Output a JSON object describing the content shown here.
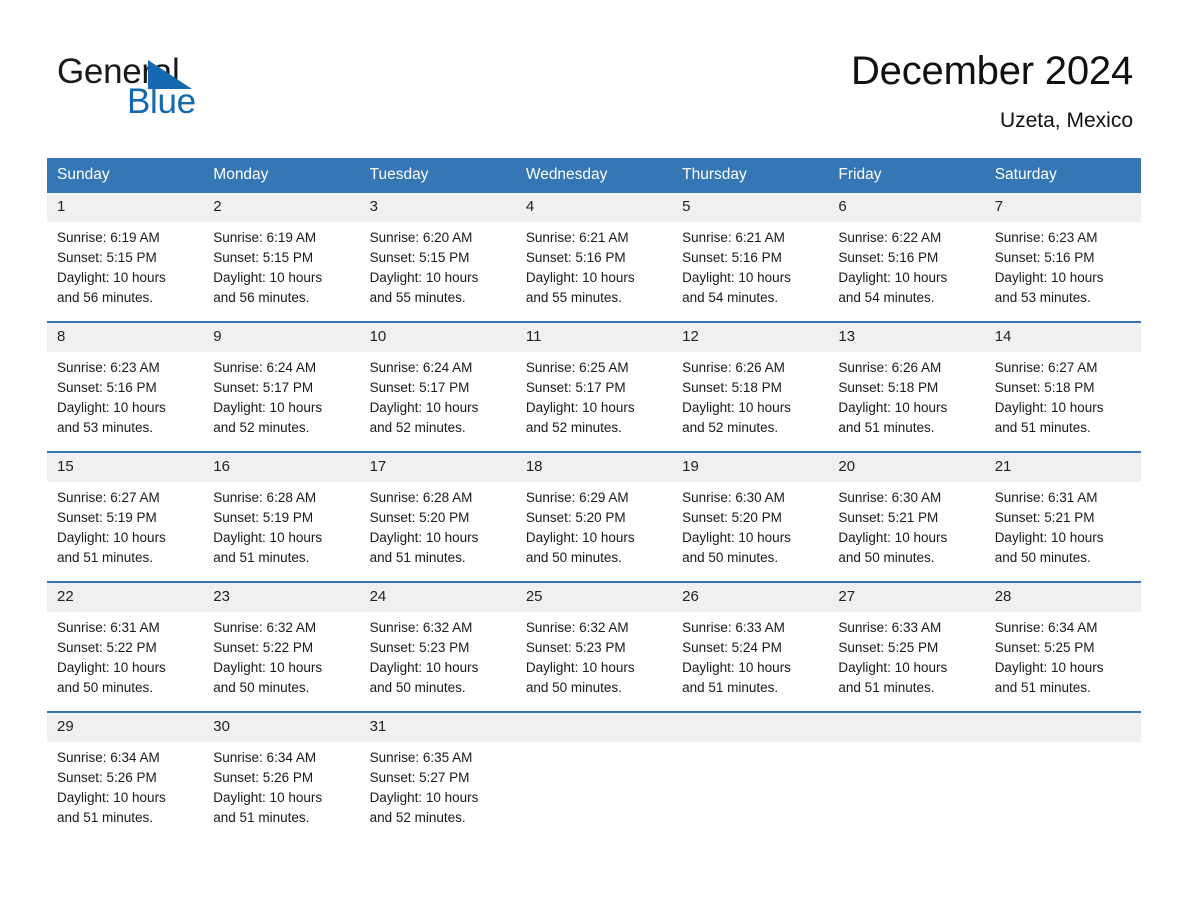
{
  "brand": {
    "name_part1": "General",
    "name_part2": "Blue",
    "triangle_color": "#1569b0",
    "blue_color": "#1569b0"
  },
  "header": {
    "title": "December 2024",
    "subtitle": "Uzeta, Mexico"
  },
  "theme": {
    "header_bar": "#3576b5",
    "row_divider": "#3576b5",
    "daynum_background": "#f0f0f0",
    "page_background": "#ffffff"
  },
  "weekdays": [
    "Sunday",
    "Monday",
    "Tuesday",
    "Wednesday",
    "Thursday",
    "Friday",
    "Saturday"
  ],
  "labels": {
    "sunrise_prefix": "Sunrise:",
    "sunset_prefix": "Sunset:",
    "daylight_prefix": "Daylight:"
  },
  "weeks": [
    [
      {
        "day": "1",
        "sunrise": "Sunrise: 6:19 AM",
        "sunset": "Sunset: 5:15 PM",
        "daylight_line1": "Daylight: 10 hours",
        "daylight_line2": "and 56 minutes."
      },
      {
        "day": "2",
        "sunrise": "Sunrise: 6:19 AM",
        "sunset": "Sunset: 5:15 PM",
        "daylight_line1": "Daylight: 10 hours",
        "daylight_line2": "and 56 minutes."
      },
      {
        "day": "3",
        "sunrise": "Sunrise: 6:20 AM",
        "sunset": "Sunset: 5:15 PM",
        "daylight_line1": "Daylight: 10 hours",
        "daylight_line2": "and 55 minutes."
      },
      {
        "day": "4",
        "sunrise": "Sunrise: 6:21 AM",
        "sunset": "Sunset: 5:16 PM",
        "daylight_line1": "Daylight: 10 hours",
        "daylight_line2": "and 55 minutes."
      },
      {
        "day": "5",
        "sunrise": "Sunrise: 6:21 AM",
        "sunset": "Sunset: 5:16 PM",
        "daylight_line1": "Daylight: 10 hours",
        "daylight_line2": "and 54 minutes."
      },
      {
        "day": "6",
        "sunrise": "Sunrise: 6:22 AM",
        "sunset": "Sunset: 5:16 PM",
        "daylight_line1": "Daylight: 10 hours",
        "daylight_line2": "and 54 minutes."
      },
      {
        "day": "7",
        "sunrise": "Sunrise: 6:23 AM",
        "sunset": "Sunset: 5:16 PM",
        "daylight_line1": "Daylight: 10 hours",
        "daylight_line2": "and 53 minutes."
      }
    ],
    [
      {
        "day": "8",
        "sunrise": "Sunrise: 6:23 AM",
        "sunset": "Sunset: 5:16 PM",
        "daylight_line1": "Daylight: 10 hours",
        "daylight_line2": "and 53 minutes."
      },
      {
        "day": "9",
        "sunrise": "Sunrise: 6:24 AM",
        "sunset": "Sunset: 5:17 PM",
        "daylight_line1": "Daylight: 10 hours",
        "daylight_line2": "and 52 minutes."
      },
      {
        "day": "10",
        "sunrise": "Sunrise: 6:24 AM",
        "sunset": "Sunset: 5:17 PM",
        "daylight_line1": "Daylight: 10 hours",
        "daylight_line2": "and 52 minutes."
      },
      {
        "day": "11",
        "sunrise": "Sunrise: 6:25 AM",
        "sunset": "Sunset: 5:17 PM",
        "daylight_line1": "Daylight: 10 hours",
        "daylight_line2": "and 52 minutes."
      },
      {
        "day": "12",
        "sunrise": "Sunrise: 6:26 AM",
        "sunset": "Sunset: 5:18 PM",
        "daylight_line1": "Daylight: 10 hours",
        "daylight_line2": "and 52 minutes."
      },
      {
        "day": "13",
        "sunrise": "Sunrise: 6:26 AM",
        "sunset": "Sunset: 5:18 PM",
        "daylight_line1": "Daylight: 10 hours",
        "daylight_line2": "and 51 minutes."
      },
      {
        "day": "14",
        "sunrise": "Sunrise: 6:27 AM",
        "sunset": "Sunset: 5:18 PM",
        "daylight_line1": "Daylight: 10 hours",
        "daylight_line2": "and 51 minutes."
      }
    ],
    [
      {
        "day": "15",
        "sunrise": "Sunrise: 6:27 AM",
        "sunset": "Sunset: 5:19 PM",
        "daylight_line1": "Daylight: 10 hours",
        "daylight_line2": "and 51 minutes."
      },
      {
        "day": "16",
        "sunrise": "Sunrise: 6:28 AM",
        "sunset": "Sunset: 5:19 PM",
        "daylight_line1": "Daylight: 10 hours",
        "daylight_line2": "and 51 minutes."
      },
      {
        "day": "17",
        "sunrise": "Sunrise: 6:28 AM",
        "sunset": "Sunset: 5:20 PM",
        "daylight_line1": "Daylight: 10 hours",
        "daylight_line2": "and 51 minutes."
      },
      {
        "day": "18",
        "sunrise": "Sunrise: 6:29 AM",
        "sunset": "Sunset: 5:20 PM",
        "daylight_line1": "Daylight: 10 hours",
        "daylight_line2": "and 50 minutes."
      },
      {
        "day": "19",
        "sunrise": "Sunrise: 6:30 AM",
        "sunset": "Sunset: 5:20 PM",
        "daylight_line1": "Daylight: 10 hours",
        "daylight_line2": "and 50 minutes."
      },
      {
        "day": "20",
        "sunrise": "Sunrise: 6:30 AM",
        "sunset": "Sunset: 5:21 PM",
        "daylight_line1": "Daylight: 10 hours",
        "daylight_line2": "and 50 minutes."
      },
      {
        "day": "21",
        "sunrise": "Sunrise: 6:31 AM",
        "sunset": "Sunset: 5:21 PM",
        "daylight_line1": "Daylight: 10 hours",
        "daylight_line2": "and 50 minutes."
      }
    ],
    [
      {
        "day": "22",
        "sunrise": "Sunrise: 6:31 AM",
        "sunset": "Sunset: 5:22 PM",
        "daylight_line1": "Daylight: 10 hours",
        "daylight_line2": "and 50 minutes."
      },
      {
        "day": "23",
        "sunrise": "Sunrise: 6:32 AM",
        "sunset": "Sunset: 5:22 PM",
        "daylight_line1": "Daylight: 10 hours",
        "daylight_line2": "and 50 minutes."
      },
      {
        "day": "24",
        "sunrise": "Sunrise: 6:32 AM",
        "sunset": "Sunset: 5:23 PM",
        "daylight_line1": "Daylight: 10 hours",
        "daylight_line2": "and 50 minutes."
      },
      {
        "day": "25",
        "sunrise": "Sunrise: 6:32 AM",
        "sunset": "Sunset: 5:23 PM",
        "daylight_line1": "Daylight: 10 hours",
        "daylight_line2": "and 50 minutes."
      },
      {
        "day": "26",
        "sunrise": "Sunrise: 6:33 AM",
        "sunset": "Sunset: 5:24 PM",
        "daylight_line1": "Daylight: 10 hours",
        "daylight_line2": "and 51 minutes."
      },
      {
        "day": "27",
        "sunrise": "Sunrise: 6:33 AM",
        "sunset": "Sunset: 5:25 PM",
        "daylight_line1": "Daylight: 10 hours",
        "daylight_line2": "and 51 minutes."
      },
      {
        "day": "28",
        "sunrise": "Sunrise: 6:34 AM",
        "sunset": "Sunset: 5:25 PM",
        "daylight_line1": "Daylight: 10 hours",
        "daylight_line2": "and 51 minutes."
      }
    ],
    [
      {
        "day": "29",
        "sunrise": "Sunrise: 6:34 AM",
        "sunset": "Sunset: 5:26 PM",
        "daylight_line1": "Daylight: 10 hours",
        "daylight_line2": "and 51 minutes."
      },
      {
        "day": "30",
        "sunrise": "Sunrise: 6:34 AM",
        "sunset": "Sunset: 5:26 PM",
        "daylight_line1": "Daylight: 10 hours",
        "daylight_line2": "and 51 minutes."
      },
      {
        "day": "31",
        "sunrise": "Sunrise: 6:35 AM",
        "sunset": "Sunset: 5:27 PM",
        "daylight_line1": "Daylight: 10 hours",
        "daylight_line2": "and 52 minutes."
      },
      {
        "day": "",
        "sunrise": "",
        "sunset": "",
        "daylight_line1": "",
        "daylight_line2": ""
      },
      {
        "day": "",
        "sunrise": "",
        "sunset": "",
        "daylight_line1": "",
        "daylight_line2": ""
      },
      {
        "day": "",
        "sunrise": "",
        "sunset": "",
        "daylight_line1": "",
        "daylight_line2": ""
      },
      {
        "day": "",
        "sunrise": "",
        "sunset": "",
        "daylight_line1": "",
        "daylight_line2": ""
      }
    ]
  ]
}
